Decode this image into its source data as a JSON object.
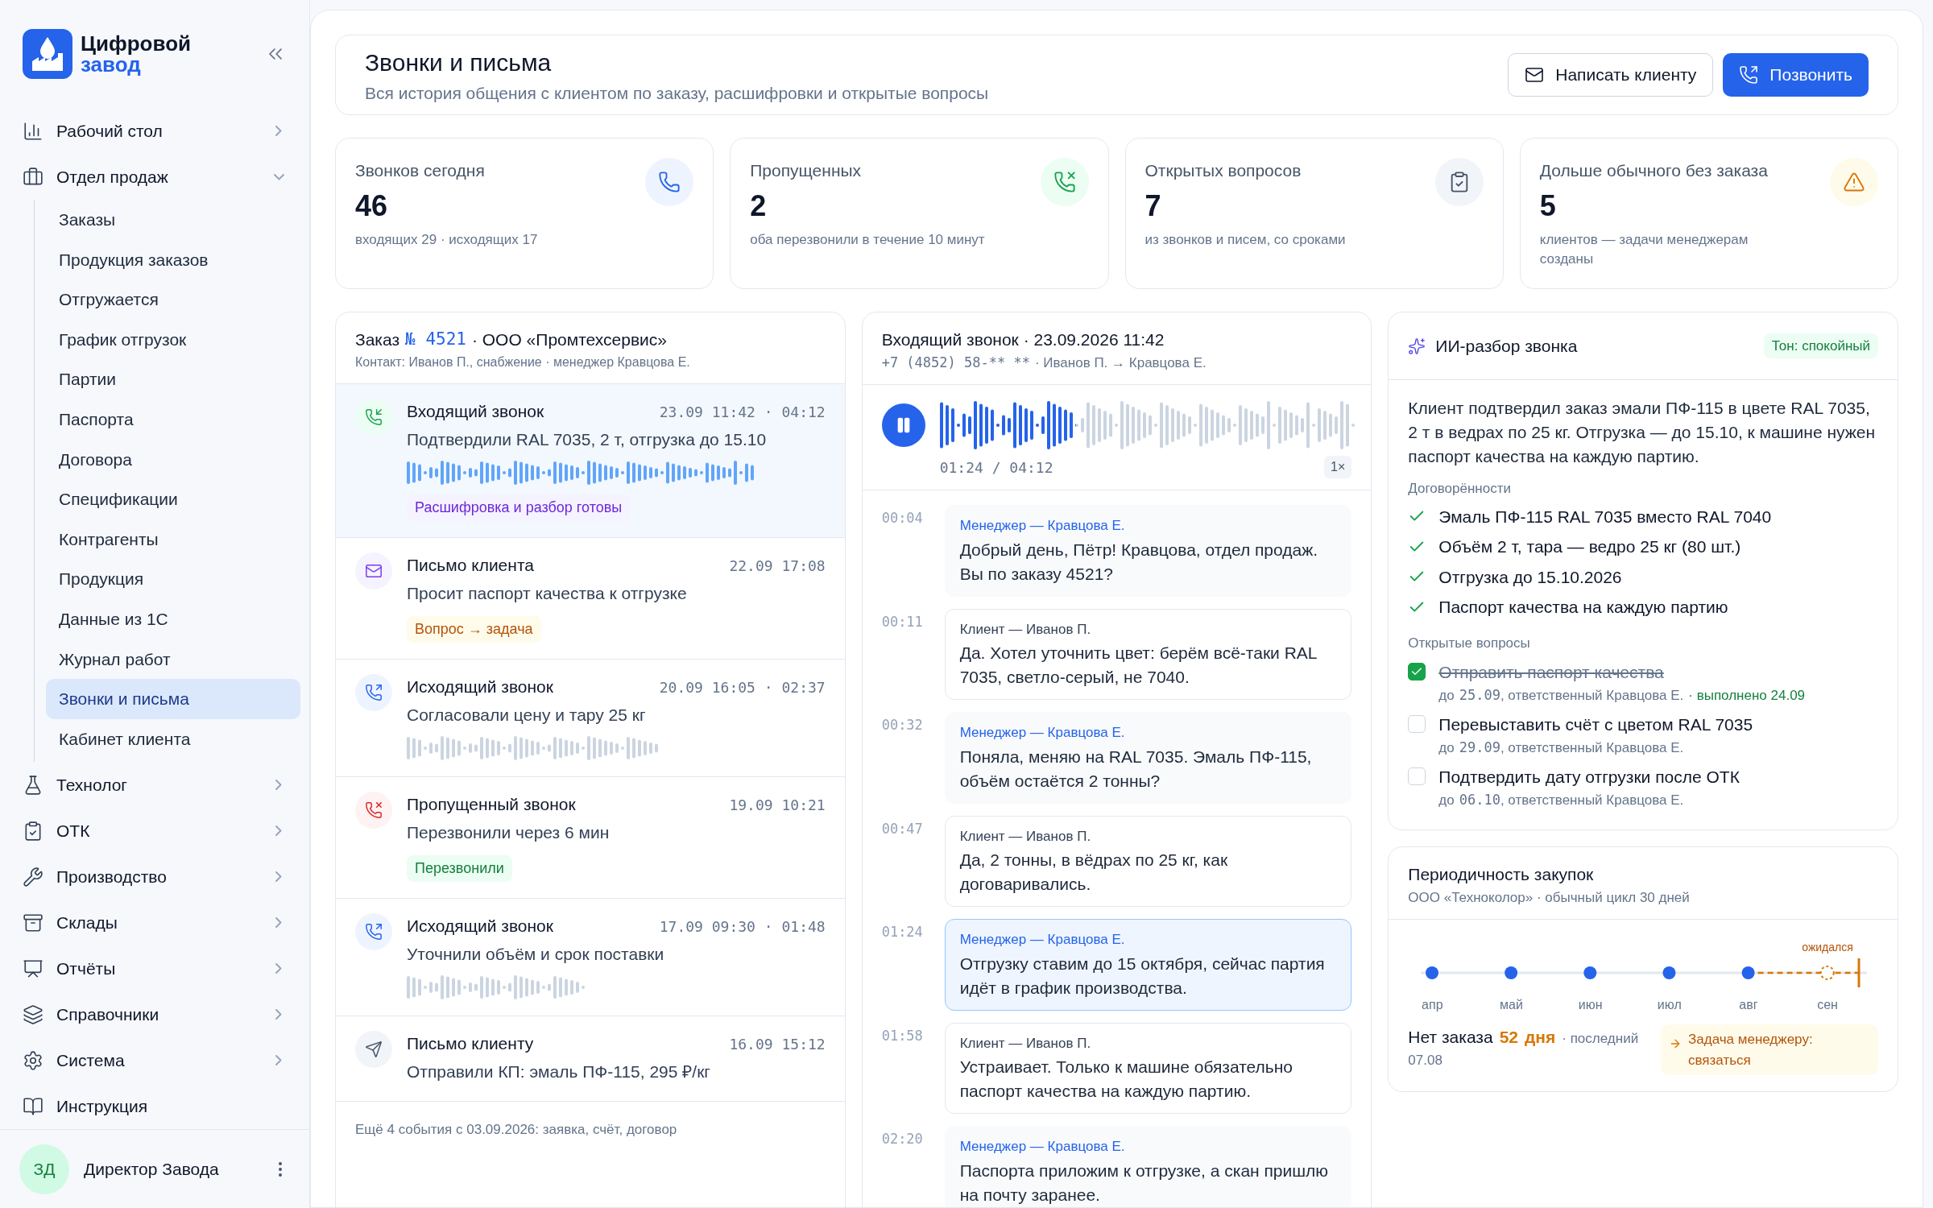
{
  "brand": {
    "line1": "Цифровой",
    "line2": "завод"
  },
  "sidebar": {
    "items": [
      {
        "label": "Рабочий стол",
        "expanded": false,
        "selected": false
      },
      {
        "label": "Отдел продаж",
        "expanded": true,
        "selected": false,
        "children": [
          {
            "label": "Заказы",
            "selected": false
          },
          {
            "label": "Продукция заказов",
            "selected": false
          },
          {
            "label": "Отгружается",
            "selected": false
          },
          {
            "label": "График отгрузок",
            "selected": false
          },
          {
            "label": "Партии",
            "selected": false
          },
          {
            "label": "Паспорта",
            "selected": false
          },
          {
            "label": "Договора",
            "selected": false
          },
          {
            "label": "Спецификации",
            "selected": false
          },
          {
            "label": "Контрагенты",
            "selected": false
          },
          {
            "label": "Продукция",
            "selected": false
          },
          {
            "label": "Данные из 1С",
            "selected": false
          },
          {
            "label": "Журнал работ",
            "selected": false
          },
          {
            "label": "Звонки и письма",
            "selected": true
          },
          {
            "label": "Кабинет клиента",
            "selected": false
          }
        ]
      },
      {
        "label": "Технолог",
        "expanded": false,
        "selected": false
      },
      {
        "label": "ОТК",
        "expanded": false,
        "selected": false
      },
      {
        "label": "Производство",
        "expanded": false,
        "selected": false
      },
      {
        "label": "Склады",
        "expanded": false,
        "selected": false
      },
      {
        "label": "Отчёты",
        "expanded": false,
        "selected": false
      },
      {
        "label": "Справочники",
        "expanded": false,
        "selected": false
      },
      {
        "label": "Система",
        "expanded": false,
        "selected": false
      },
      {
        "label": "Инструкция",
        "selected": false
      }
    ],
    "user": {
      "initials": "ЗД",
      "name": "Директор Завода"
    }
  },
  "header": {
    "title": "Звонки и письма",
    "subtitle": "Вся история общения с клиентом по заказу, расшифровки и открытые вопросы",
    "buttons": [
      {
        "label": "Написать клиенту",
        "kind": "secondary"
      },
      {
        "label": "Позвонить",
        "kind": "primary"
      }
    ]
  },
  "stats": [
    {
      "label": "Звонков сегодня",
      "value": "46",
      "note": "входящих 29 · исходящих 17",
      "kind": "phone"
    },
    {
      "label": "Пропущенных",
      "value": "2",
      "note": "оба перезвонили в течение 10 минут",
      "kind": "missed"
    },
    {
      "label": "Открытых вопросов",
      "value": "7",
      "note": "из звонков и писем, со сроками",
      "kind": "tasks"
    },
    {
      "label": "Дольше обычного без заказа",
      "value": "5",
      "note": "клиентов — задачи менеджерам созданы",
      "kind": "warning"
    }
  ],
  "timeline": {
    "title_prefix": "Заказ",
    "order_number": "№ 4521",
    "title_rest": "· ООО «Промтехсервис»",
    "subtitle": "Контакт: Иванов П., снабжение · менеджер Кравцова Е.",
    "items": [
      {
        "kind": "incoming",
        "title": "Входящий звонок",
        "time": "23.09 11:42 · 04:12",
        "text": "Подтвердили RAL 7035, 2 т, отгрузка до 15.10",
        "recording": true,
        "selected": true,
        "tag": {
          "text": "Расшифровка и разбор готовы",
          "kind": "ready"
        }
      },
      {
        "kind": "mail_in",
        "title": "Письмо клиента",
        "time": "22.09 17:08",
        "text": "Просит паспорт качества к отгрузке",
        "recording": false,
        "selected": false,
        "tag": {
          "text": "Вопрос → задача",
          "kind": "task"
        }
      },
      {
        "kind": "outgoing",
        "title": "Исходящий звонок",
        "time": "20.09 16:05 · 02:37",
        "text": "Согласовали цену и тару 25 кг",
        "recording": true,
        "selected": false
      },
      {
        "kind": "missed",
        "title": "Пропущенный звонок",
        "time": "19.09 10:21",
        "text": "Перезвонили через 6 мин",
        "recording": false,
        "selected": false,
        "tag": {
          "text": "Перезвонили",
          "kind": "resolved"
        }
      },
      {
        "kind": "outgoing",
        "title": "Исходящий звонок",
        "time": "17.09 09:30 · 01:48",
        "text": "Уточнили объём и срок поставки",
        "recording": true,
        "selected": false
      },
      {
        "kind": "mail_out",
        "title": "Письмо клиенту",
        "time": "16.09 15:12",
        "text": "Отправили КП: эмаль ПФ-115, 295 ₽/кг",
        "recording": false,
        "selected": false
      }
    ],
    "footer": "Ещё 4 события с 03.09.2026: заявка, счёт, договор"
  },
  "call": {
    "title": "Входящий звонок · 23.09.2026 11:42",
    "phone": "+7 (4852) 58-** **",
    "route": "· Иванов П. → Кравцова Е.",
    "player": {
      "playing": true,
      "level": 0.33,
      "position": "01:24 / 04:12",
      "speed": "1×"
    },
    "messages": [
      {
        "time": "00:04",
        "kind": "manager",
        "speaker": "Менеджер — Кравцова Е.",
        "text": "Добрый день, Пётр! Кравцова, отдел продаж. Вы по заказу 4521?",
        "selected": false
      },
      {
        "time": "00:11",
        "kind": "client",
        "speaker": "Клиент — Иванов П.",
        "text": "Да. Хотел уточнить цвет: берём всё-таки RAL 7035, светло-серый, не 7040.",
        "selected": false
      },
      {
        "time": "00:32",
        "kind": "manager",
        "speaker": "Менеджер — Кравцова Е.",
        "text": "Поняла, меняю на RAL 7035. Эмаль ПФ-115, объём остаётся 2 тонны?",
        "selected": false
      },
      {
        "time": "00:47",
        "kind": "client",
        "speaker": "Клиент — Иванов П.",
        "text": "Да, 2 тонны, в вёдрах по 25 кг, как договаривались.",
        "selected": false
      },
      {
        "time": "01:24",
        "kind": "manager",
        "speaker": "Менеджер — Кравцова Е.",
        "text": "Отгрузку ставим до 15 октября, сейчас партия идёт в график производства.",
        "selected": true
      },
      {
        "time": "01:58",
        "kind": "client",
        "speaker": "Клиент — Иванов П.",
        "text": "Устраивает. Только к машине обязательно паспорт качества на каждую партию.",
        "selected": false
      },
      {
        "time": "02:20",
        "kind": "manager",
        "speaker": "Менеджер — Кравцова Е.",
        "text": "Паспорта приложим к отгрузке, а скан пришлю на почту заранее.",
        "selected": false
      }
    ]
  },
  "analysis": {
    "title": "ИИ-разбор звонка",
    "tone_badge": "Тон: спокойный",
    "summary": "Клиент подтвердил заказ эмали ПФ-115 в цвете RAL 7035, 2 т в ведрах по 25 кг. Отгрузка — до 15.10, к машине нужен паспорт качества на каждую партию.",
    "agreements_title": "Договорённости",
    "agreements": [
      "Эмаль ПФ-115 RAL 7035 вместо RAL 7040",
      "Объём 2 т, тара — ведро 25 кг (80 шт.)",
      "Отгрузка до 15.10.2026",
      "Паспорт качества на каждую партию"
    ],
    "questions_title": "Открытые вопросы",
    "questions": [
      {
        "text": "Отправить паспорт качества",
        "checked": true,
        "due_label": "до",
        "due_date": "25.09",
        "owner": ", ответственный Кравцова Е.",
        "done_note": "· выполнено 24.09"
      },
      {
        "text": "Перевыставить счёт с цветом RAL 7035",
        "checked": false,
        "due_label": "до",
        "due_date": "29.09",
        "owner": ", ответственный Кравцова Е."
      },
      {
        "text": "Подтвердить дату отгрузки после ОТК",
        "checked": false,
        "due_label": "до",
        "due_date": "06.10",
        "owner": ", ответственный Кравцова Е."
      }
    ]
  },
  "periodicity": {
    "title": "Периодичность закупок",
    "subtitle": "ООО «Техноколор» · обычный цикл 30 дней",
    "expected_label": "ожидался",
    "months": [
      {
        "label": "апр",
        "kind": "order"
      },
      {
        "label": "май",
        "kind": "order"
      },
      {
        "label": "июн",
        "kind": "order"
      },
      {
        "label": "июл",
        "kind": "order"
      },
      {
        "label": "авг",
        "kind": "order"
      },
      {
        "label": "сен",
        "kind": "expected"
      }
    ],
    "status_prefix": "Нет заказа",
    "days": "52",
    "days_unit": "дня",
    "status_suffix": "· последний",
    "last_date": "07.08",
    "task": "Задача менеджеру: связаться"
  }
}
